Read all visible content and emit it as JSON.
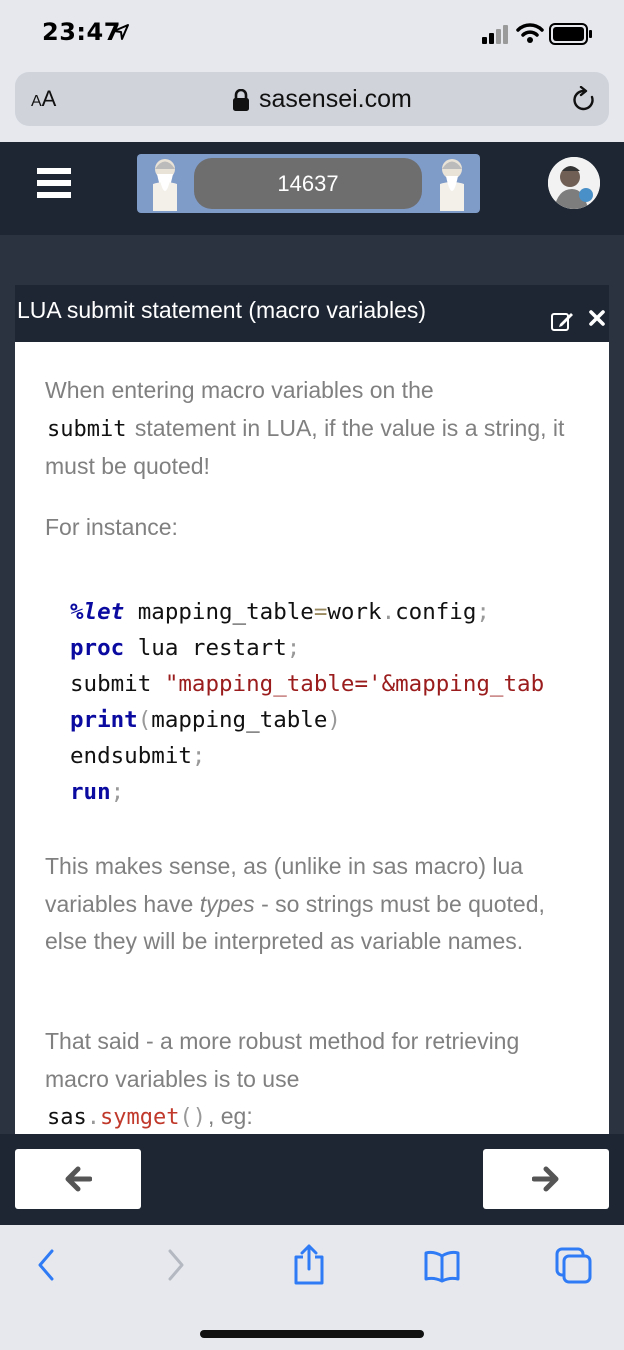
{
  "status_bar": {
    "time": "23:47"
  },
  "browser": {
    "aa_small": "A",
    "aa_large": "A",
    "url": "sasensei.com"
  },
  "header": {
    "score": "14637"
  },
  "card": {
    "title": "LUA submit statement (macro variables)",
    "p1_a": "When entering macro variables on the",
    "p1_code": "submit",
    "p1_b": " statement in LUA, if the value is a string, it must be quoted!",
    "p2": "For instance:",
    "code": {
      "l1_kw": "%let",
      "l1_a": " mapping_table",
      "l1_op": "=",
      "l1_b": "work",
      "l1_dot": ".",
      "l1_c": "config",
      "l1_semi": ";",
      "l2_kw": "proc",
      "l2_a": " lua restart",
      "l2_semi": ";",
      "l3_a": "submit ",
      "l3_str": "\"mapping_table='&mapping_tab",
      "l4_kw": "print",
      "l4_p1": "(",
      "l4_a": "mapping_table",
      "l4_p2": ")",
      "l5_a": "endsubmit",
      "l5_semi": ";",
      "l6_kw": "run",
      "l6_semi": ";"
    },
    "p3_a": "This makes sense, as (unlike in sas macro) lua variables have ",
    "p3_em": "types",
    "p3_b": " - so strings must be quoted, else they will be interpreted as variable names.",
    "p4_a": "That said - a more robust method for retrieving macro variables is to use",
    "p4_code_a": "sas",
    "p4_code_dot": ".",
    "p4_code_fn": "symget",
    "p4_code_paren": "()",
    "p4_b": ", eg:"
  }
}
